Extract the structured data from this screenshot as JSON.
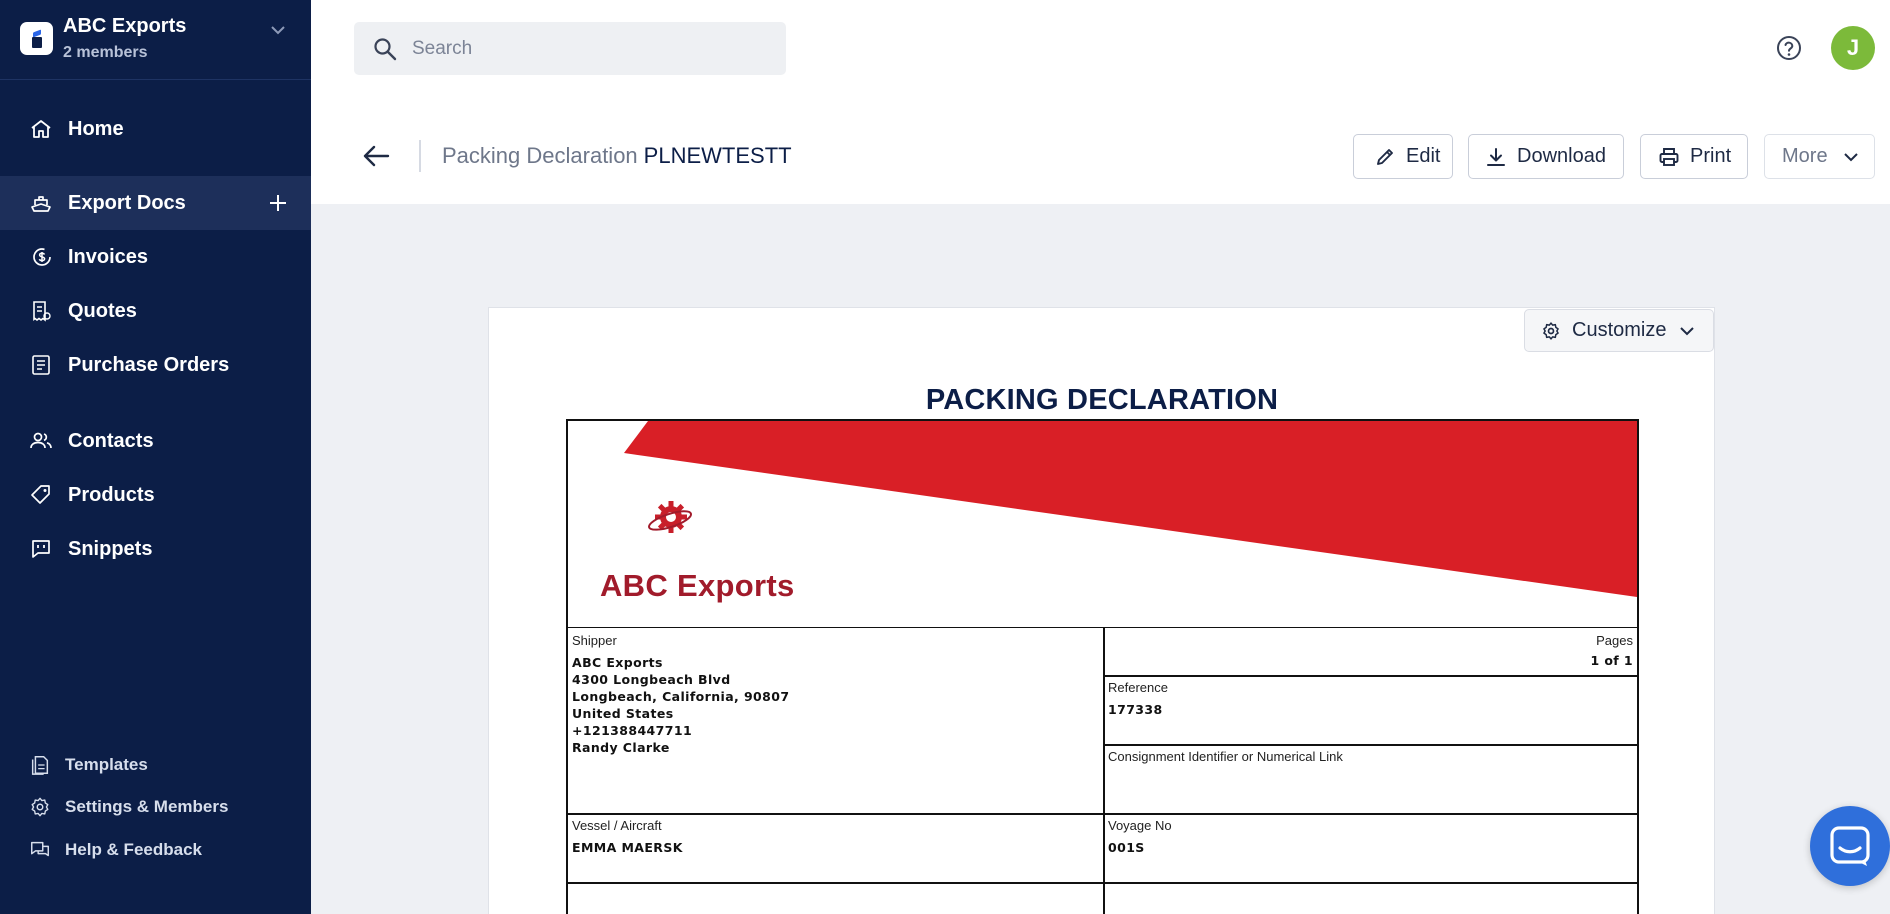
{
  "org": {
    "name": "ABC Exports",
    "members": "2 members"
  },
  "nav": {
    "home": "Home",
    "export_docs": "Export Docs",
    "invoices": "Invoices",
    "quotes": "Quotes",
    "purchase_orders": "Purchase Orders",
    "contacts": "Contacts",
    "products": "Products",
    "snippets": "Snippets"
  },
  "footer_nav": {
    "templates": "Templates",
    "settings": "Settings & Members",
    "help": "Help & Feedback"
  },
  "search": {
    "placeholder": "Search"
  },
  "user": {
    "initial": "J",
    "avatar_color": "#7cba3a"
  },
  "header": {
    "doc_type": "Packing Declaration",
    "doc_id": "PLNEWTESTT"
  },
  "actions": {
    "edit": "Edit",
    "download": "Download",
    "print": "Print",
    "more": "More"
  },
  "customize_label": "Customize",
  "document": {
    "heading": "PACKING DECLARATION",
    "logo_text": "ABC Exports",
    "shipper": {
      "label": "Shipper",
      "lines": [
        "ABC Exports",
        "4300 Longbeach Blvd",
        "Longbeach, California, 90807",
        "United States",
        "+121388447711",
        "Randy Clarke"
      ]
    },
    "pages": {
      "label": "Pages",
      "value": "1 of 1"
    },
    "reference": {
      "label": "Reference",
      "value": "177338"
    },
    "consignment": {
      "label": "Consignment Identifier or Numerical Link",
      "value": ""
    },
    "vessel": {
      "label": "Vessel / Aircraft",
      "value": "EMMA MAERSK"
    },
    "voyage": {
      "label": "Voyage No",
      "value": "001S"
    }
  },
  "colors": {
    "sidebar_bg": "#0c1e47",
    "accent_red": "#d91f26",
    "logo_red": "#a11b2b",
    "chat_blue": "#2f6fdb"
  }
}
